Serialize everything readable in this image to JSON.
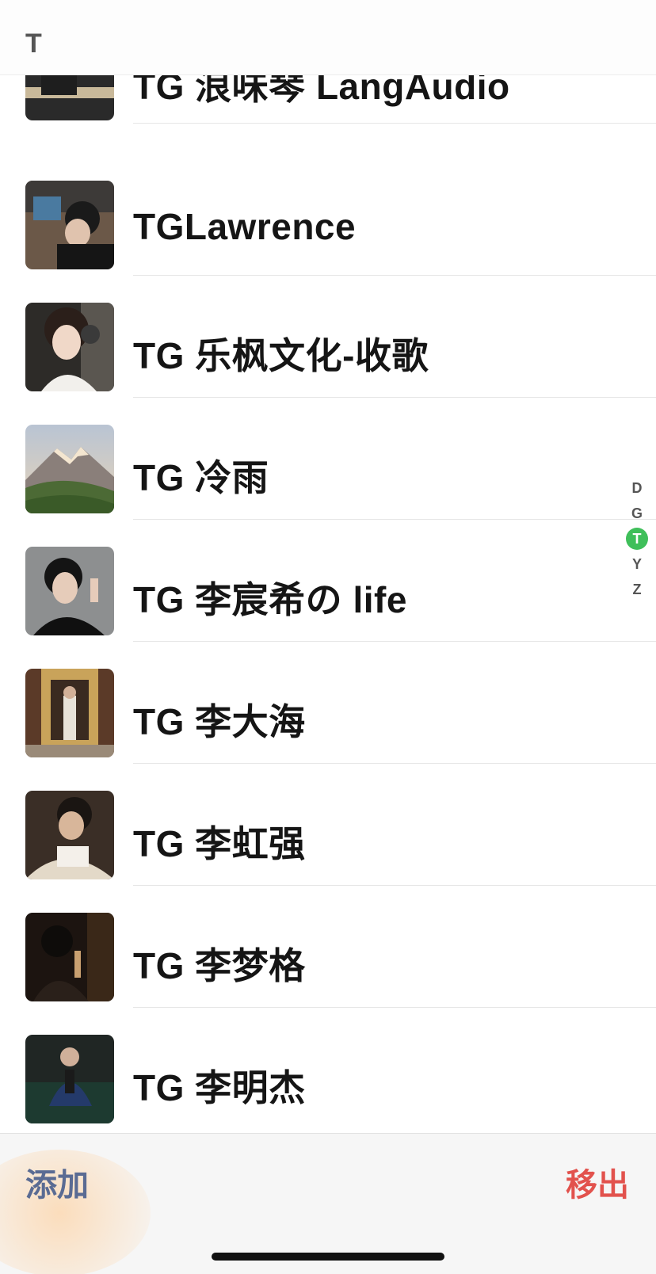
{
  "section": {
    "letter": "T"
  },
  "contacts": [
    {
      "name": "TG 浪味琴 LangAudio"
    },
    {
      "name": "TGLawrence"
    },
    {
      "name": "TG 乐枫文化-收歌"
    },
    {
      "name": "TG 冷雨"
    },
    {
      "name": "TG 李宸希の life"
    },
    {
      "name": "TG 李大海"
    },
    {
      "name": "TG 李虹强"
    },
    {
      "name": "TG 李梦格"
    },
    {
      "name": "TG 李明杰"
    }
  ],
  "index": [
    "D",
    "G",
    "T",
    "Y",
    "Z"
  ],
  "index_active": "T",
  "bottom": {
    "add_label": "添加",
    "remove_label": "移出"
  },
  "colors": {
    "accent_green": "#3fbf5a",
    "add_blue": "#5a6b93",
    "remove_red": "#e2524d"
  }
}
